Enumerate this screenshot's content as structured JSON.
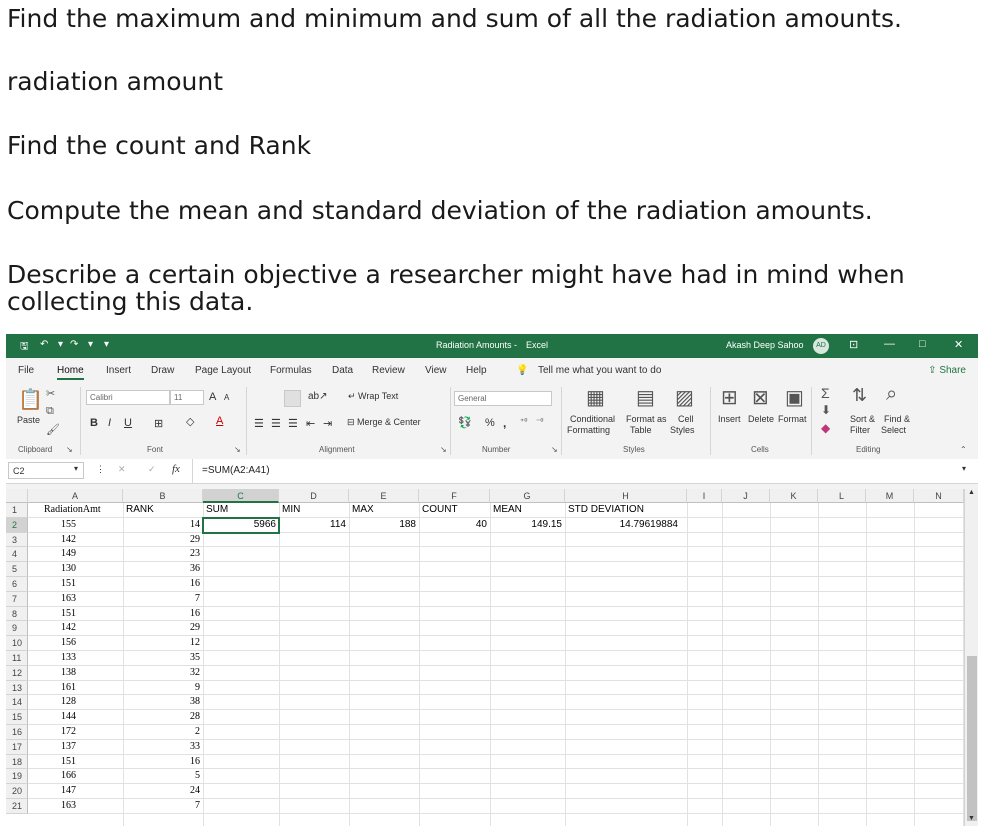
{
  "questions": [
    "Find the maximum and minimum and sum of all the radiation amounts.",
    "radiation amount",
    "Find the count and Rank",
    "Compute the mean and standard deviation of the radiation amounts.",
    "Describe a certain objective a researcher might have had in mind when collecting this data."
  ],
  "titlebar": {
    "doc_title": "Radiation Amounts",
    "app": "Excel",
    "separator": "-",
    "user": "Akash Deep Sahoo",
    "initials": "AD",
    "min_glyph": "—",
    "restore_glyph": "□",
    "close_glyph": "✕",
    "ribbon_display_glyph": "⊡",
    "qa_dropdown": "▾"
  },
  "menu": {
    "tabs": [
      "File",
      "Home",
      "Insert",
      "Draw",
      "Page Layout",
      "Formulas",
      "Data",
      "Review",
      "View",
      "Help"
    ],
    "active": "Home",
    "tell_me": "Tell me what you want to do",
    "share": "Share"
  },
  "ribbon": {
    "paste": "Paste",
    "clipboard": "Clipboard",
    "font_name": "Calibri",
    "font_size": "11",
    "font": "Font",
    "bold": "B",
    "italic": "I",
    "underline": "U",
    "grow_font": "A",
    "shrink_font": "A",
    "font_color_letter": "A",
    "wrap_text": "Wrap Text",
    "merge_center": "Merge & Center",
    "alignment": "Alignment",
    "number_format": "General",
    "percent": "%",
    "comma": ",",
    "number": "Number",
    "conditional": "Conditional",
    "formatting": "Formatting",
    "format_as": "Format as",
    "table": "Table",
    "cell": "Cell",
    "styles_label": "Styles",
    "styles": "Styles",
    "insert": "Insert",
    "delete": "Delete",
    "format": "Format",
    "cells": "Cells",
    "sort": "Sort &",
    "filter": "Filter",
    "find": "Find &",
    "select": "Select",
    "editing": "Editing"
  },
  "formula_bar": {
    "name_box": "C2",
    "fx": "fx",
    "formula": "=SUM(A2:A41)"
  },
  "columns": [
    "A",
    "B",
    "C",
    "D",
    "E",
    "F",
    "G",
    "H",
    "I",
    "J",
    "K",
    "L",
    "M",
    "N"
  ],
  "rows": [
    "1",
    "2",
    "3",
    "4",
    "5",
    "6",
    "7",
    "8",
    "9",
    "10",
    "11",
    "12",
    "13",
    "14",
    "15",
    "16",
    "17",
    "18",
    "19",
    "20",
    "21"
  ],
  "headers": {
    "A": "RadiationAmt",
    "B": "RANK",
    "C": "SUM",
    "D": "MIN",
    "E": "MAX",
    "F": "COUNT",
    "G": "MEAN",
    "H": "STD DEVIATION"
  },
  "radiation": [
    "155",
    "142",
    "149",
    "130",
    "151",
    "163",
    "151",
    "142",
    "156",
    "133",
    "138",
    "161",
    "128",
    "144",
    "172",
    "137",
    "151",
    "166",
    "147",
    "163"
  ],
  "rank": [
    "14",
    "29",
    "23",
    "36",
    "16",
    "7",
    "16",
    "29",
    "12",
    "35",
    "32",
    "9",
    "38",
    "28",
    "2",
    "33",
    "16",
    "5",
    "24",
    "7"
  ],
  "results": {
    "sum": "5966",
    "min": "114",
    "max": "188",
    "count": "40",
    "mean": "149.15",
    "std": "14.79619884"
  }
}
